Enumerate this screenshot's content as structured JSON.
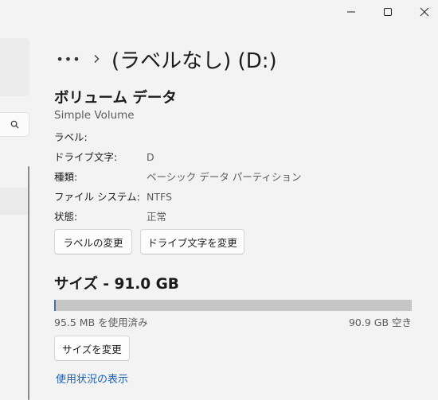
{
  "window": {
    "controls": {
      "minimize_icon": "minimize-icon",
      "maximize_icon": "maximize-icon",
      "close_icon": "close-icon"
    }
  },
  "nav": {
    "search_icon": "search-icon"
  },
  "breadcrumb": {
    "more": "•••",
    "title": "(ラベルなし) (D:)"
  },
  "volume": {
    "heading": "ボリューム データ",
    "subtitle": "Simple Volume",
    "properties": [
      {
        "label": "ラベル:",
        "value": ""
      },
      {
        "label": "ドライブ文字:",
        "value": "D"
      },
      {
        "label": "種類:",
        "value": "ベーシック データ パーティション"
      },
      {
        "label": "ファイル システム:",
        "value": "NTFS"
      },
      {
        "label": "状態:",
        "value": "正常"
      }
    ],
    "buttons": {
      "change_label": "ラベルの変更",
      "change_drive_letter": "ドライブ文字を変更"
    }
  },
  "size": {
    "heading": "サイズ - 91.0 GB",
    "used_text": "95.5 MB を使用済み",
    "free_text": "90.9 GB 空き",
    "used_fraction": 0.001,
    "resize_button": "サイズを変更",
    "usage_link": "使用状況の表示"
  },
  "colors": {
    "background": "#f3f3f3",
    "bar_track": "#c6c6c6",
    "bar_fill": "#4a6fa5",
    "link": "#1a5fb4"
  }
}
